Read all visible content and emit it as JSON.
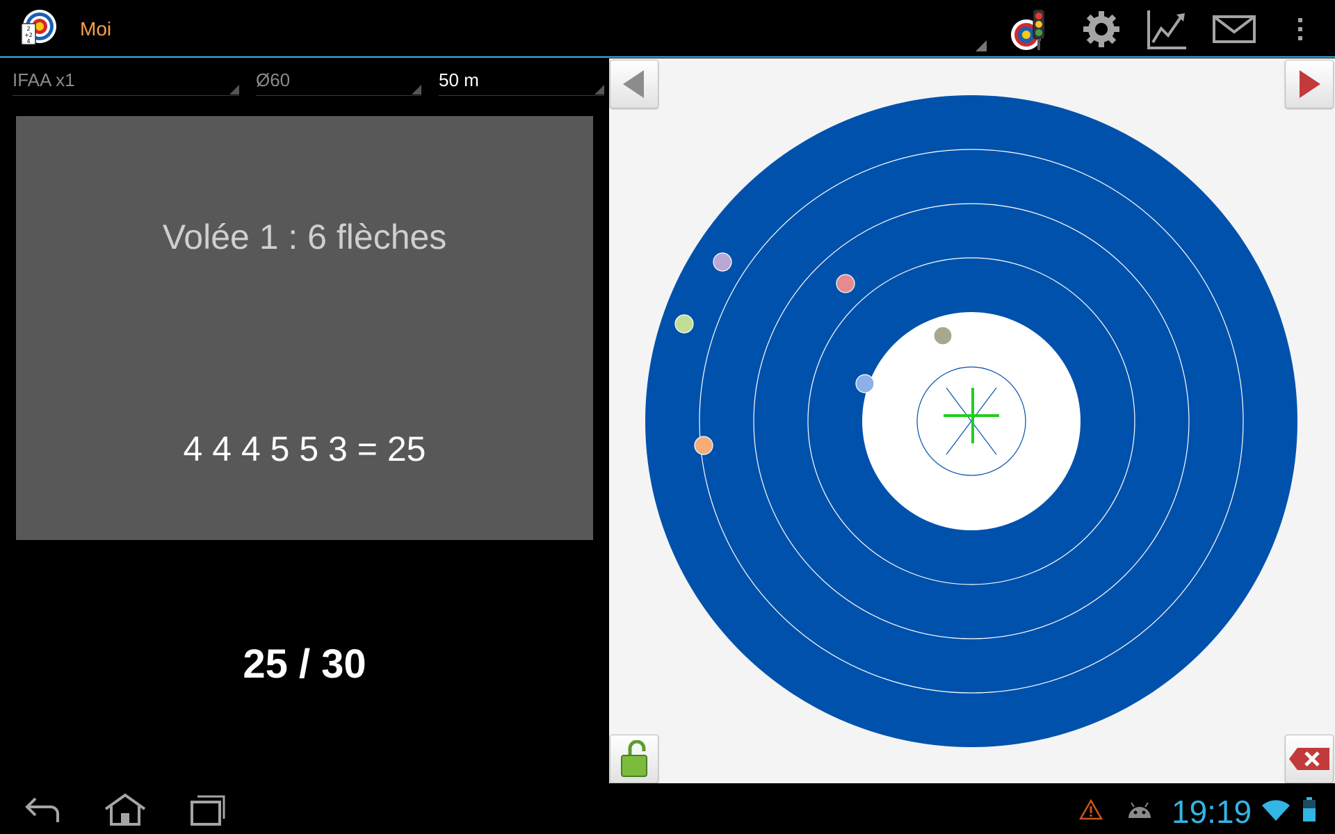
{
  "action_bar": {
    "title": "Moi",
    "actions": [
      "traffic-light-target-icon",
      "settings-gear-icon",
      "stats-chart-icon",
      "mail-icon",
      "overflow-menu-icon"
    ]
  },
  "spinners": [
    {
      "value": "IFAA x1",
      "active": false
    },
    {
      "value": "Ø60",
      "active": false
    },
    {
      "value": "50 m",
      "active": true
    }
  ],
  "end_card": {
    "title": "Volée 1 : 6 flèches",
    "scores_line": "4 4 4 5 5 3 = 25"
  },
  "total": "25 / 30",
  "target": {
    "ring_color": "#0051ac",
    "center_color": "#ffffff",
    "crosshair_color": "#1ecf1e",
    "arrows": [
      {
        "score": 4,
        "color": "#b9a7d6"
      },
      {
        "score": 4,
        "color": "#e58a8e"
      },
      {
        "score": 4,
        "color": "#c2dd96"
      },
      {
        "score": 3,
        "color": "#a9a88f"
      },
      {
        "score": 5,
        "color": "#8cb0e8"
      },
      {
        "score": 5,
        "color": "#f5ad78"
      }
    ]
  },
  "status_bar": {
    "time": "19:19"
  },
  "colors": {
    "accent": "#33b5e5",
    "title": "#f6a04d"
  }
}
